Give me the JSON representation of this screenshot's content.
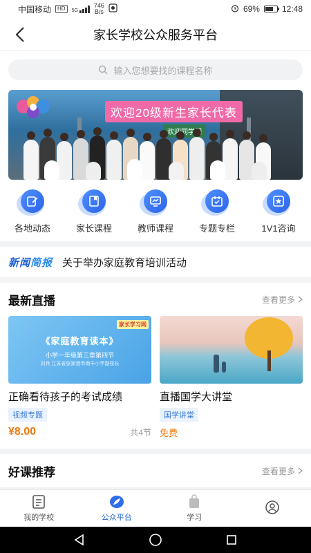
{
  "status_bar": {
    "carrier": "中国移动",
    "network_badge": "HD",
    "signal_label": "5G",
    "speed": "746",
    "speed_unit": "B/s",
    "battery": "69%",
    "battery_level": 0.69,
    "time": "12:48"
  },
  "nav": {
    "title": "家长学校公众服务平台"
  },
  "search": {
    "placeholder": "输入您想要找的课程名称"
  },
  "banner": {
    "title": "欢迎20级新生家长代表",
    "sign": "欢迎同学们"
  },
  "quick_links": [
    {
      "label": "各地动态",
      "icon": "edit-icon"
    },
    {
      "label": "家长课程",
      "icon": "book-icon"
    },
    {
      "label": "教师课程",
      "icon": "chart-icon"
    },
    {
      "label": "专题专栏",
      "icon": "calendar-icon"
    },
    {
      "label": "1V1咨询",
      "icon": "star-icon"
    }
  ],
  "news": {
    "tag_part1": "新闻",
    "tag_part2": "简报",
    "text": "关于举办家庭教育培训活动"
  },
  "live": {
    "title": "最新直播",
    "more": "查看更多",
    "cards": [
      {
        "thumb_title": "《家庭教育读本》",
        "thumb_sub": "小学一年级第三章第四节",
        "thumb_sub2": "刘兵 江苏省张家港市南丰小学副校长",
        "thumb_badge": "家长学习网",
        "title": "正确看待孩子的考试成绩",
        "tag": "视频专题",
        "price": "¥8.00",
        "lessons": "共4节"
      },
      {
        "title": "直播国学大讲堂",
        "tag": "国学讲堂",
        "price": "免费",
        "lessons": ""
      }
    ]
  },
  "recommend": {
    "title": "好课推荐",
    "more": "查看更多"
  },
  "tabbar": [
    {
      "label": "我的学校",
      "icon": "document-icon",
      "active": false
    },
    {
      "label": "公众平台",
      "icon": "leaf-icon",
      "active": true
    },
    {
      "label": "学习",
      "icon": "bag-icon",
      "active": false
    },
    {
      "label": "",
      "icon": "user-icon",
      "active": false
    }
  ],
  "colors": {
    "accent": "#1a5fd4",
    "price": "#f0770f",
    "banner_pink": "#f06aa8"
  }
}
